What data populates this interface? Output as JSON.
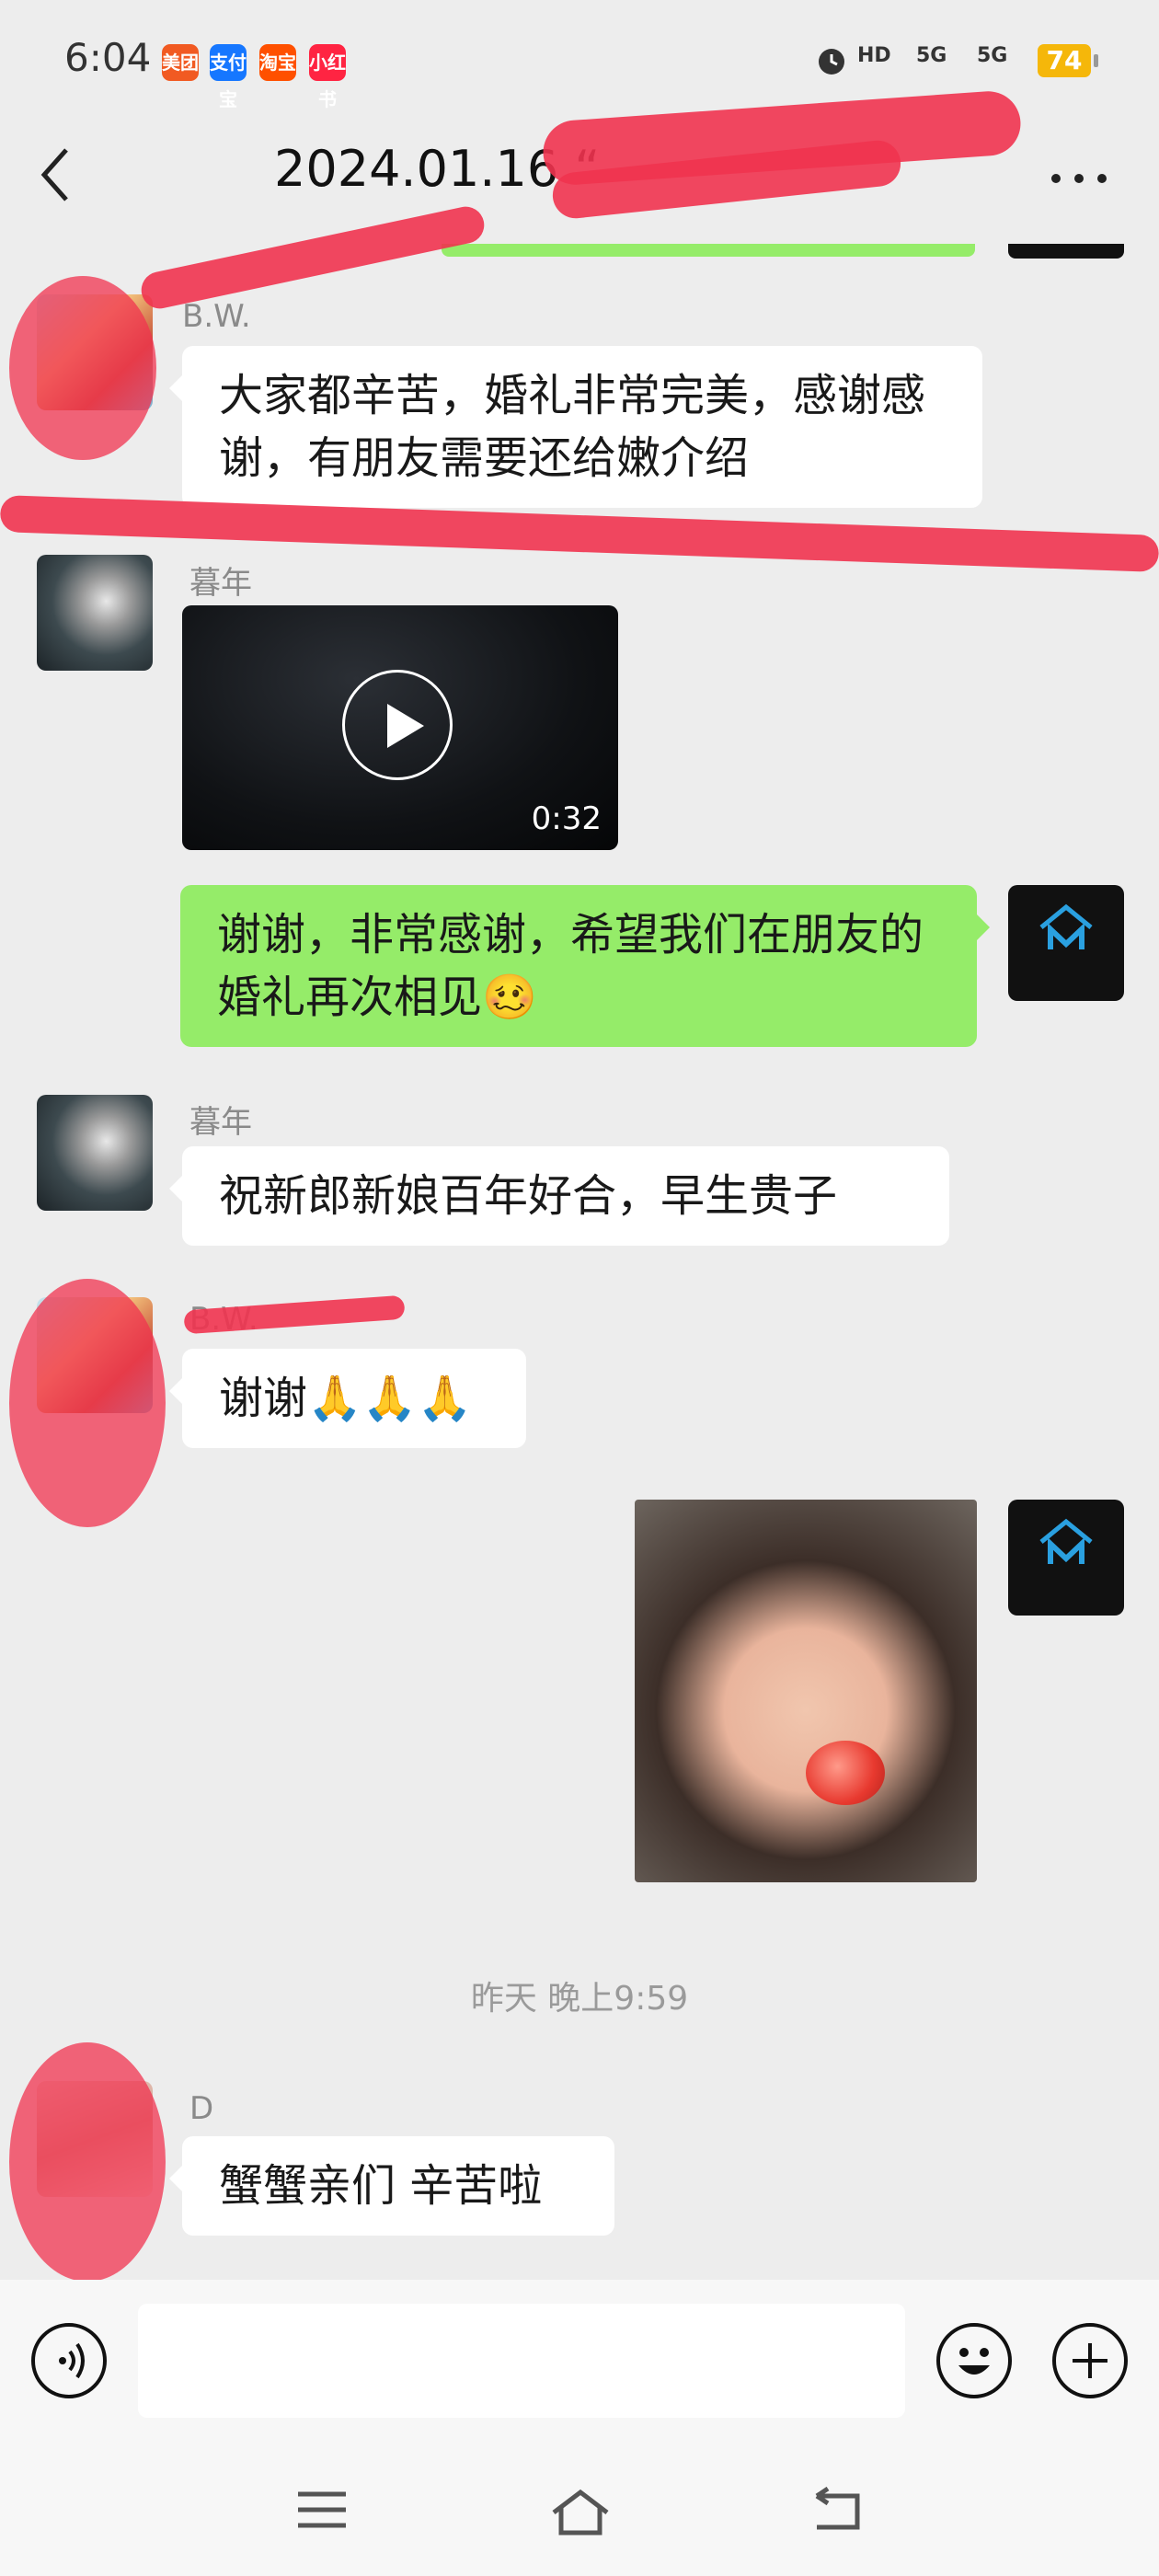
{
  "status_bar": {
    "time": "6:04",
    "apps": [
      "美团",
      "支付宝",
      "淘宝",
      "小红书"
    ],
    "indicators": [
      "HD",
      "5G",
      "5G"
    ],
    "battery": "74"
  },
  "header": {
    "title": "2024.01.16 “",
    "back_icon": "chevron-left-icon",
    "more_icon": "more-icon"
  },
  "messages": [
    {
      "sender": "B.W.",
      "text": "大家都辛苦，婚礼非常完美，感谢感谢，有朋友需要还给嫩介绍"
    },
    {
      "sender": "暮年",
      "type": "video",
      "duration": "0:32"
    },
    {
      "sender": "me",
      "text": "谢谢，非常感谢，希望我们在朋友的婚礼再次相见",
      "emoji": "🥴"
    },
    {
      "sender": "暮年",
      "text": "祝新郎新娘百年好合，早生贵子"
    },
    {
      "sender": "B.W.",
      "text": "谢谢",
      "emoji": "🙏🙏🙏"
    },
    {
      "sender": "me",
      "type": "image"
    },
    {
      "sender": "D",
      "text": "蟹蟹亲们 辛苦啦"
    }
  ],
  "time_separator": "昨天 晚上9:59",
  "input_bar": {
    "voice_icon": "voice-icon",
    "emoji_icon": "emoji-icon",
    "plus_icon": "plus-icon"
  },
  "colors": {
    "background": "#ededed",
    "my_bubble": "#95ec69",
    "other_bubble": "#ffffff",
    "scribble": "#f0334f"
  }
}
